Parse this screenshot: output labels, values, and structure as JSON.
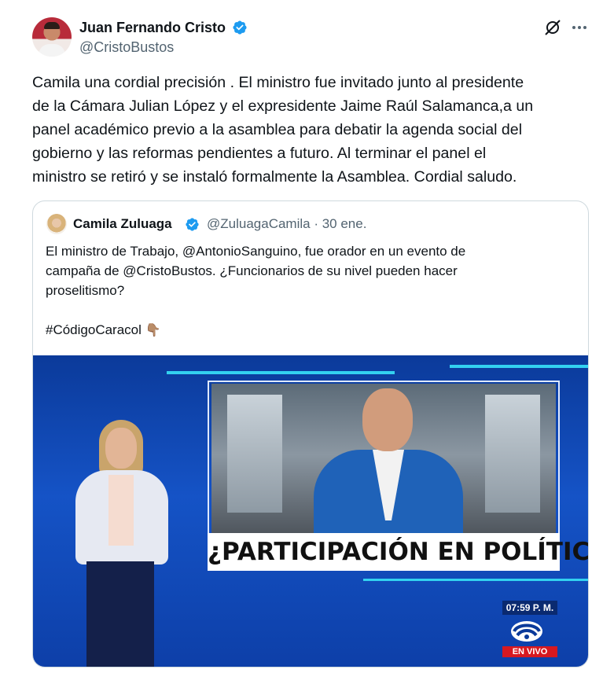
{
  "author": {
    "name": "Juan Fernando Cristo",
    "handle": "@CristoBustos",
    "verified_icon": "verified-badge-icon",
    "accent_color": "#1d9bf0"
  },
  "actions": {
    "grok_icon": "grok-slash-icon",
    "more_icon": "more-dots-icon"
  },
  "tweet": {
    "lines": [
      "Camila una cordial precisión . El ministro fue invitado junto al presidente",
      "de la Cámara Julian López y el expresidente Jaime Raúl Salamanca,a un",
      "panel académico previo a la asamblea para debatir la agenda social del",
      "gobierno y las reformas pendientes a futuro. Al terminar el panel el",
      "ministro se retiró y se instaló formalmente la Asamblea. Cordial saludo."
    ]
  },
  "quoted": {
    "name": "Camila Zuluaga",
    "handle_date": "@ZuluagaCamila · 30 ene.",
    "lines": [
      "El ministro de Trabajo, @AntonioSanguino, fue orador en un evento de",
      "campaña de @CristoBustos. ¿Funcionarios de su nivel pueden hacer",
      "proselitismo?"
    ],
    "hashtag": "#CódigoCaracol",
    "emoji": "👇🏽",
    "media": {
      "banner": "¿PARTICIPACIÓN EN POLÍTICA?",
      "time": "07:59 P. M.",
      "live": "EN VIVO"
    }
  }
}
